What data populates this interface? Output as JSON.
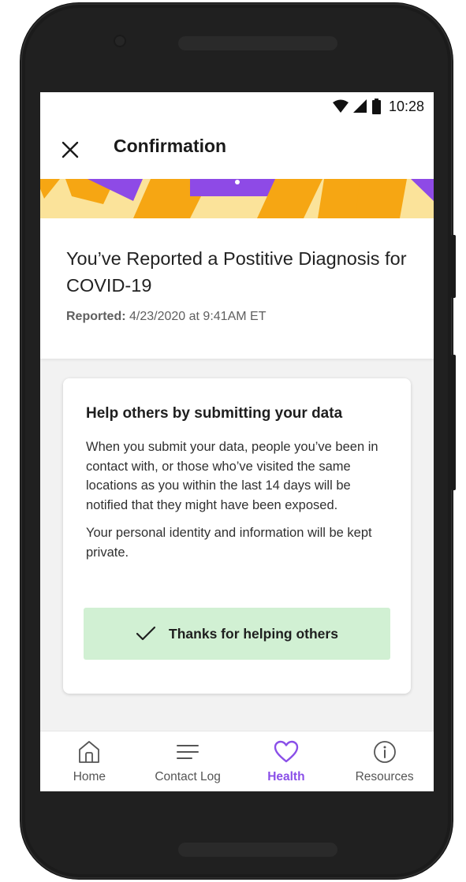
{
  "status_bar": {
    "time": "10:28"
  },
  "app_bar": {
    "title": "Confirmation"
  },
  "report": {
    "title": "You’ve Reported a Postitive Diagnosis for COVID-19",
    "reported_label": "Reported:",
    "reported_value": "4/23/2020 at 9:41AM ET"
  },
  "info_card": {
    "title": "Help others by submitting your data",
    "paragraph_1": "When you submit your data, people you’ve been in contact with, or those who’ve visited the same locations as you within the last 14 days will be notified that they might have been exposed.",
    "paragraph_2": "Your personal identity and information will be kept private.",
    "confirmation_label": "Thanks for helping others"
  },
  "bottom_nav": {
    "items": [
      {
        "label": "Home",
        "icon": "home-icon",
        "active": false
      },
      {
        "label": "Contact Log",
        "icon": "list-icon",
        "active": false
      },
      {
        "label": "Health",
        "icon": "heart-icon",
        "active": true
      },
      {
        "label": "Resources",
        "icon": "info-icon",
        "active": false
      }
    ]
  },
  "colors": {
    "accent": "#8a4fe8",
    "banner_background": "#fbe39a",
    "banner_orange": "#f6a613",
    "banner_purple": "#8e4ae6",
    "success_background": "#d1f0d3"
  }
}
